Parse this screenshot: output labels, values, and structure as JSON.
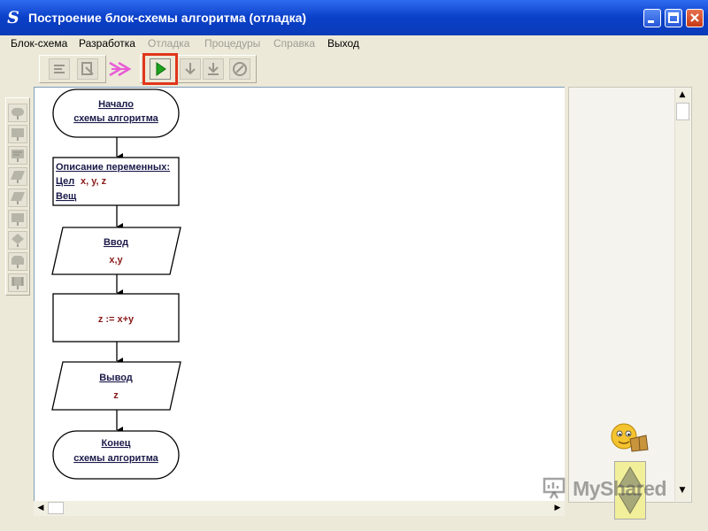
{
  "window": {
    "app_icon": "S",
    "title": "Построение блок-схемы алгоритма (отладка)"
  },
  "menu": [
    {
      "label": "Блок-схема",
      "enabled": true
    },
    {
      "label": "Разработка",
      "enabled": true
    },
    {
      "label": "Отладка",
      "enabled": false
    },
    {
      "label": "Процедуры",
      "enabled": false
    },
    {
      "label": "Справка",
      "enabled": false
    },
    {
      "label": "Выход",
      "enabled": true
    }
  ],
  "toolbar": {
    "icons": [
      "step-icon",
      "breakpoint-icon",
      "run-icon",
      "step-into-icon",
      "step-over-icon",
      "stop-icon"
    ],
    "highlight_color": "#e0361b",
    "run_color": "#1ea31e"
  },
  "palette_icons": [
    "terminator-shape-icon",
    "process-shape-icon",
    "declaration-shape-icon",
    "io-shape-icon",
    "output-shape-icon",
    "assign-shape-icon",
    "decision-shape-icon",
    "loop-shape-icon",
    "call-shape-icon"
  ],
  "flowchart": {
    "start": {
      "line1": "Начало",
      "line2": "схемы алгоритма"
    },
    "declarations": {
      "line1": "Описание переменных:",
      "int_kw": "Цел",
      "int_vars": "x, y, z",
      "real_kw": "Вещ"
    },
    "input": {
      "title": "Ввод",
      "value": "x,y"
    },
    "process": {
      "text": "z := x+y"
    },
    "output": {
      "title": "Вывод",
      "value": "z"
    },
    "end": {
      "line1": "Конец",
      "line2": "схемы алгоритма"
    },
    "text_color": "#1a1a4a",
    "value_color": "#8b1a1a"
  },
  "watermark": {
    "text": "MyShared"
  }
}
